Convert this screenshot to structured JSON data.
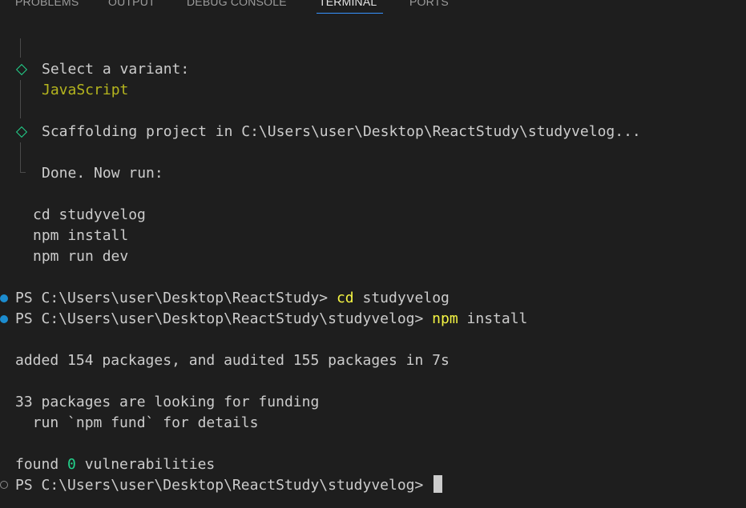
{
  "panel": {
    "tabs": [
      {
        "label": "PROBLEMS"
      },
      {
        "label": "OUTPUT"
      },
      {
        "label": "DEBUG CONSOLE"
      },
      {
        "label": "TERMINAL"
      },
      {
        "label": "PORTS"
      }
    ],
    "active_tab": "TERMINAL"
  },
  "colors": {
    "background": "#1e1e1e",
    "text": "#cccccc",
    "accent_green": "#23d18b",
    "variant_olive": "#b5b51e",
    "command_yellow": "#f5f543",
    "decoration_blue": "#1c8ccf",
    "tab_underline": "#3794ff"
  },
  "terminal": {
    "prompt_variant": "Select a variant:",
    "variant_value": "JavaScript",
    "scaffolding": "Scaffolding project in C:\\Users\\user\\Desktop\\ReactStudy\\studyvelog...",
    "done": "Done. Now run:",
    "next_steps": [
      "cd studyvelog",
      "npm install",
      "npm run dev"
    ],
    "cmd1": {
      "prompt": "PS C:\\Users\\user\\Desktop\\ReactStudy> ",
      "command": "cd",
      "args": " studyvelog"
    },
    "cmd2": {
      "prompt": "PS C:\\Users\\user\\Desktop\\ReactStudy\\studyvelog> ",
      "command": "npm",
      "args": " install"
    },
    "added": "added 154 packages, and audited 155 packages in 7s",
    "funding": "33 packages are looking for funding",
    "fund_hint": "  run `npm fund` for details",
    "found_pre": "found ",
    "found_count": "0",
    "found_post": " vulnerabilities",
    "final_prompt": "PS C:\\Users\\user\\Desktop\\ReactStudy\\studyvelog> "
  }
}
